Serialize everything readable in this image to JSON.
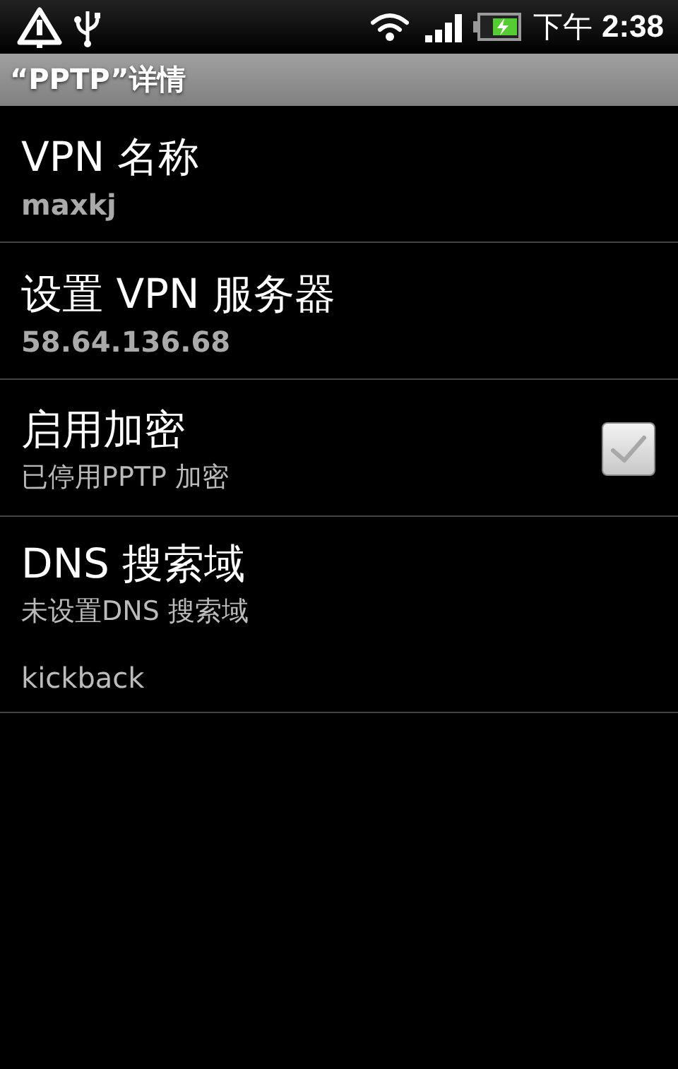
{
  "status_bar": {
    "time_prefix": "下午",
    "time": "2:38"
  },
  "title_bar": {
    "title": "“PPTP”详情"
  },
  "settings": [
    {
      "kind": "value",
      "title": "VPN 名称",
      "value": "maxkj"
    },
    {
      "kind": "value",
      "title": "设置 VPN 服务器",
      "value": "58.64.136.68"
    },
    {
      "kind": "toggle",
      "title": "启用加密",
      "summary": "已停用PPTP 加密",
      "checked": false
    },
    {
      "kind": "summary",
      "title": "DNS 搜索域",
      "summary": "未设置DNS 搜索域",
      "value": "kickback"
    }
  ]
}
